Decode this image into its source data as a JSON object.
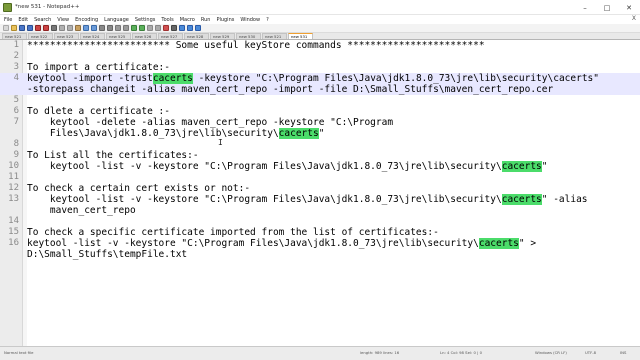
{
  "window": {
    "title": "*new 531 - Notepad++",
    "minimize": "–",
    "maximize": "□",
    "close": "✕"
  },
  "menu": {
    "items": [
      "File",
      "Edit",
      "Search",
      "View",
      "Encoding",
      "Language",
      "Settings",
      "Tools",
      "Macro",
      "Run",
      "Plugins",
      "Window",
      "?"
    ],
    "close": "X"
  },
  "tabs": [
    {
      "label": "new 521"
    },
    {
      "label": "new 522"
    },
    {
      "label": "new 523"
    },
    {
      "label": "new 524"
    },
    {
      "label": "new 525"
    },
    {
      "label": "new 526"
    },
    {
      "label": "new 527"
    },
    {
      "label": "new 528"
    },
    {
      "label": "new 529"
    },
    {
      "label": "new 530"
    },
    {
      "label": "new 521"
    },
    {
      "label": "new 531",
      "active": true
    }
  ],
  "editor": {
    "current_line": 4,
    "highlight_word": "cacerts",
    "lines": [
      {
        "n": "1",
        "text": "************************* Some useful keyStore commands ************************"
      },
      {
        "n": "2",
        "text": ""
      },
      {
        "n": "3",
        "text": "To import a certificate:-"
      },
      {
        "n": "4",
        "text": "keytool -import -trustcacerts -keystore \"C:\\Program Files\\Java\\jdk1.8.0_73\\jre\\lib\\security\\cacerts\""
      },
      {
        "n": "",
        "text": "-storepass changeit -alias maven_cert_repo -import -file D:\\Small_Stuffs\\maven_cert_repo.cer"
      },
      {
        "n": "5",
        "text": ""
      },
      {
        "n": "6",
        "text": "To dlete a certificate :-"
      },
      {
        "n": "7",
        "text": "    keytool -delete -alias maven_cert_repo -keystore \"C:\\Program"
      },
      {
        "n": "",
        "text": "    Files\\Java\\jdk1.8.0_73\\jre\\lib\\security\\cacerts\""
      },
      {
        "n": "8",
        "text": ""
      },
      {
        "n": "9",
        "text": "To List all the certificates:-"
      },
      {
        "n": "10",
        "text": "    keytool -list -v -keystore \"C:\\Program Files\\Java\\jdk1.8.0_73\\jre\\lib\\security\\cacerts\""
      },
      {
        "n": "11",
        "text": ""
      },
      {
        "n": "12",
        "text": "To check a certain cert exists or not:-"
      },
      {
        "n": "13",
        "text": "    keytool -list -v -keystore \"C:\\Program Files\\Java\\jdk1.8.0_73\\jre\\lib\\security\\cacerts\" -alias"
      },
      {
        "n": "",
        "text": "    maven_cert_repo"
      },
      {
        "n": "14",
        "text": ""
      },
      {
        "n": "15",
        "text": "To check a specific certificate imported from the list of certificates:-"
      },
      {
        "n": "16",
        "text": "keytool -list -v -keystore \"C:\\Program Files\\Java\\jdk1.8.0_73\\jre\\lib\\security\\cacerts\" >"
      },
      {
        "n": "",
        "text": "D:\\Small_Stuffs\\tempFile.txt"
      }
    ]
  },
  "cursor_glyph": "I",
  "status": {
    "type": "Normal text file",
    "length": "length: 989   lines: 16",
    "position": "Ln: 4   Col: 98   Sel: 0 | 0",
    "eol": "Windows (CR LF)",
    "encoding": "UTF-8",
    "mode": "INS"
  },
  "colors": {
    "highlight": "#4bdc6a",
    "current_line": "#e8e8ff",
    "gutter": "#ececec"
  }
}
